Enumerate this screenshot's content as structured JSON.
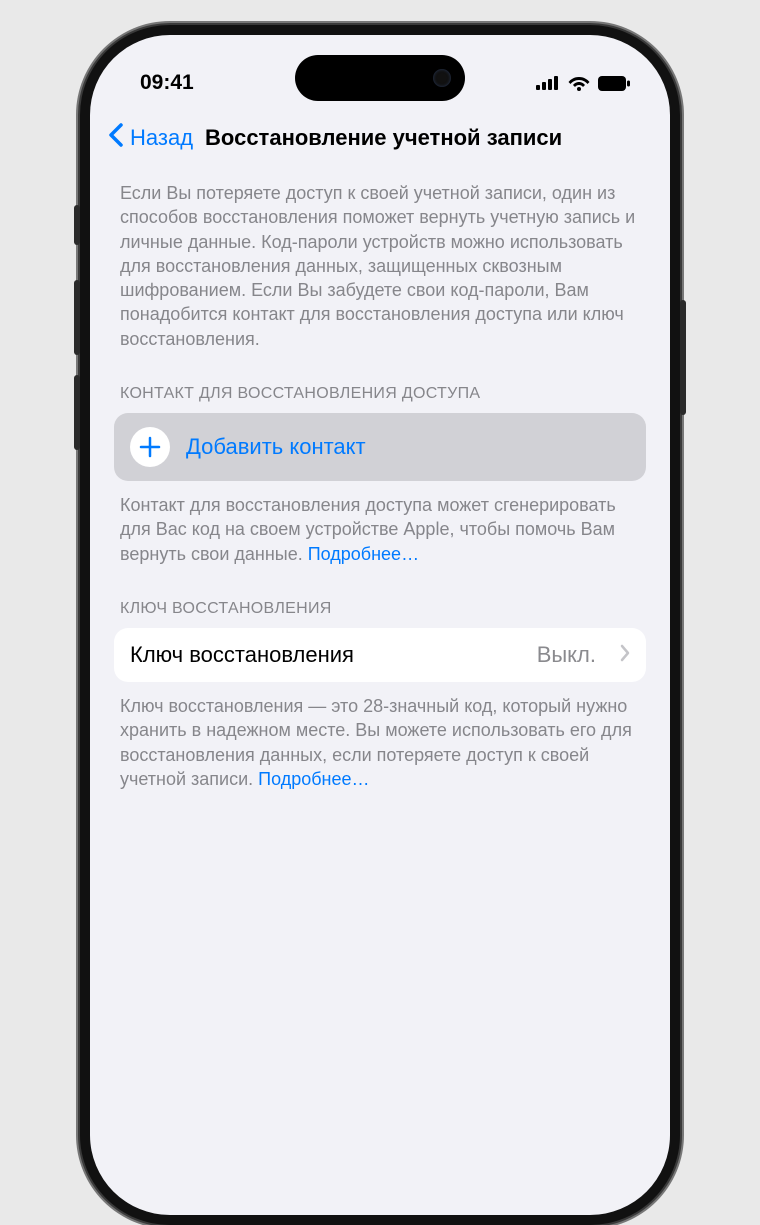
{
  "status": {
    "time": "09:41"
  },
  "nav": {
    "back": "Назад",
    "title": "Восстановление учетной записи"
  },
  "intro": "Если Вы потеряете доступ к своей учетной записи, один из способов восстановления поможет вернуть учетную запись и личные данные. Код-пароли устройств можно использовать для восстановления данных, защищенных сквозным шифрованием. Если Вы забудете свои код-пароли, Вам понадобится контакт для восстановления доступа или ключ восстановления.",
  "recovery_contact": {
    "header": "КОНТАКТ ДЛЯ ВОССТАНОВЛЕНИЯ ДОСТУПА",
    "add_label": "Добавить контакт",
    "footer": "Контакт для восстановления доступа может сгенерировать для Вас код на своем устройстве Apple, чтобы помочь Вам вернуть свои данные. ",
    "more": "Подробнее…"
  },
  "recovery_key": {
    "header": "КЛЮЧ ВОССТАНОВЛЕНИЯ",
    "label": "Ключ восстановления",
    "value": "Выкл.",
    "footer": "Ключ восстановления — это 28-значный код, который нужно хранить в надежном месте. Вы можете использовать его для восстановления данных, если потеряете доступ к своей учетной записи. ",
    "more": "Подробнее…"
  }
}
